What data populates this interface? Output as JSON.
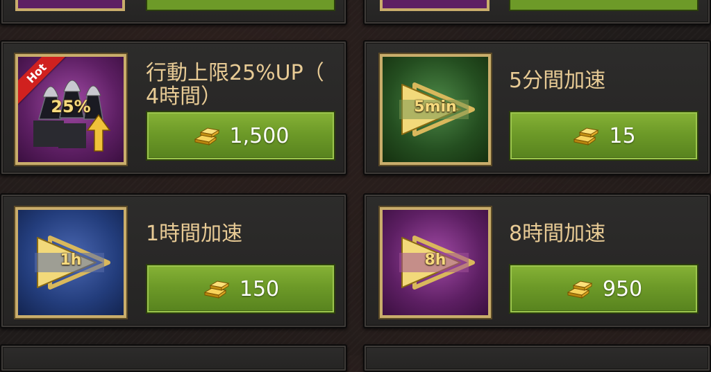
{
  "items": [
    {
      "title_line1": "行動上限25%UP（",
      "title_line2": "4時間）",
      "price": "1,500",
      "badge": "25%",
      "tag": "Hot",
      "icon": "march-capacity-boost-icon"
    },
    {
      "title_line1": "5分間加速",
      "price": "15",
      "badge": "5min",
      "icon": "speedup-arrow-icon"
    },
    {
      "title_line1": "1時間加速",
      "price": "150",
      "badge": "1h",
      "icon": "speedup-arrow-icon"
    },
    {
      "title_line1": "8時間加速",
      "price": "950",
      "badge": "8h",
      "icon": "speedup-arrow-icon"
    }
  ],
  "currency_icon": "gold-bars-icon",
  "colors": {
    "button_green": "#6d9a28",
    "title_gold": "#e8cb95",
    "frame_gold": "#c9ad6b",
    "hot_red": "#d0211f"
  }
}
